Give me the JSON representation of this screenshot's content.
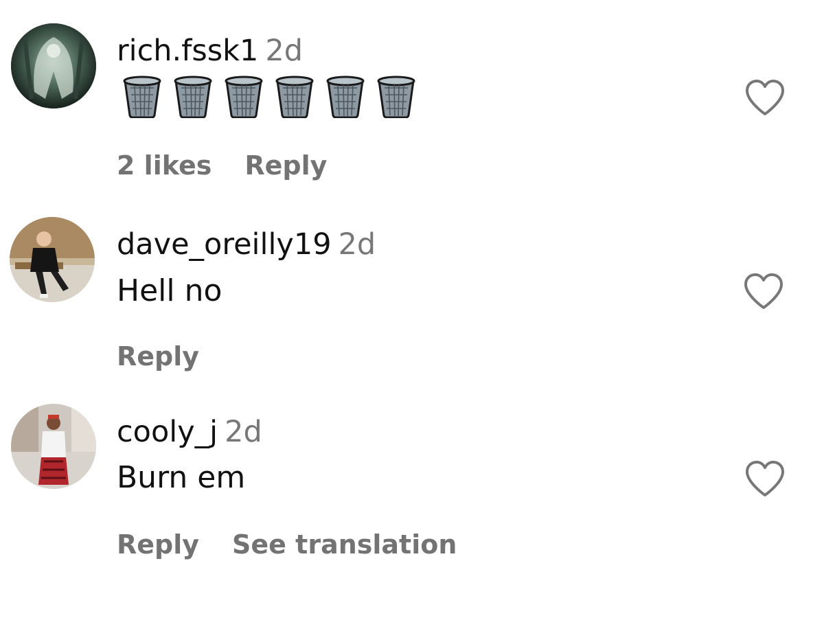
{
  "comments": [
    {
      "username": "rich.fssk1",
      "time": "2d",
      "text": "",
      "emoji": [
        "wastebasket",
        "wastebasket",
        "wastebasket",
        "wastebasket",
        "wastebasket",
        "wastebasket"
      ],
      "likes": "2 likes",
      "reply": "Reply",
      "translate": ""
    },
    {
      "username": "dave_oreilly19",
      "time": "2d",
      "text": "Hell no",
      "likes": "",
      "reply": "Reply",
      "translate": ""
    },
    {
      "username": "cooly_j",
      "time": "2d",
      "text": "Burn em",
      "likes": "",
      "reply": "Reply",
      "translate": "See translation"
    }
  ],
  "icons": {
    "like": "heart-outline-icon",
    "emoji": "wastebasket-icon"
  },
  "colors": {
    "username": "#111111",
    "meta": "#737373",
    "heart": "#777777"
  }
}
